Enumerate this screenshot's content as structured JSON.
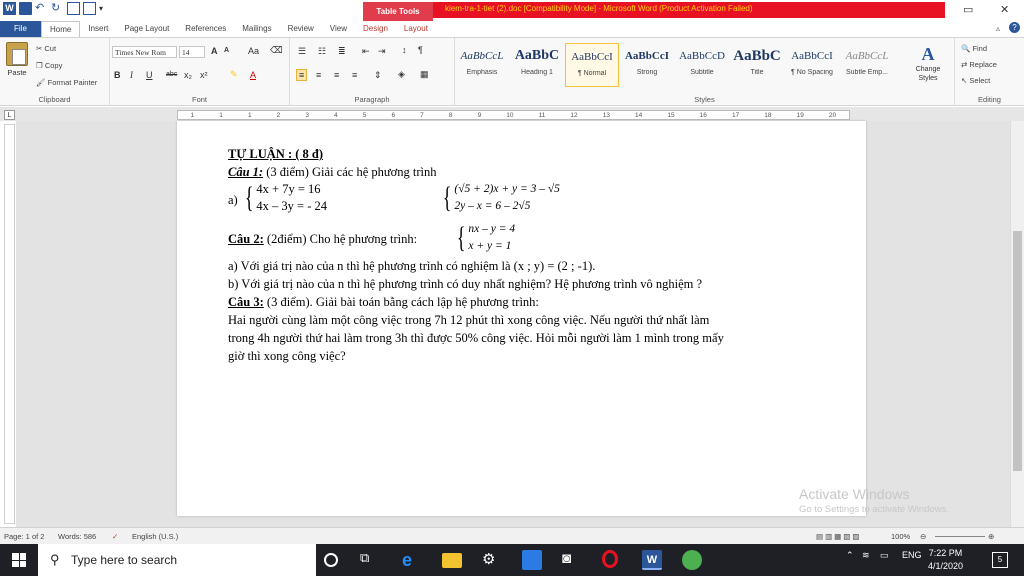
{
  "titlebar": {
    "context_tab": "Table Tools",
    "document_title": "kiem-tra-1-tiet (2).doc [Compatibility Mode] - Microsoft Word (Product Activation Failed)",
    "restore_glyph": "▭",
    "close_glyph": "✕"
  },
  "tabs": [
    {
      "label": "File"
    },
    {
      "label": "Home"
    },
    {
      "label": "Insert"
    },
    {
      "label": "Page Layout"
    },
    {
      "label": "References"
    },
    {
      "label": "Mailings"
    },
    {
      "label": "Review"
    },
    {
      "label": "View"
    },
    {
      "label": "Design"
    },
    {
      "label": "Layout"
    }
  ],
  "clipboard": {
    "paste": "Paste",
    "cut": "Cut",
    "copy": "Copy",
    "format_painter": "Format Painter",
    "label": "Clipboard"
  },
  "font": {
    "name": "Times New Rom",
    "size": "14",
    "label": "Font",
    "bold": "B",
    "italic": "I",
    "underline": "U",
    "strike": "abc",
    "sub": "x₂",
    "sup": "x²",
    "grow": "A",
    "shrink": "A",
    "case": "Aa",
    "color": "A"
  },
  "paragraph": {
    "label": "Paragraph",
    "pilcrow": "¶"
  },
  "styles": {
    "label": "Styles",
    "items": [
      {
        "sample": "AaBbCcL",
        "name": "Emphasis"
      },
      {
        "sample": "AaBbC",
        "name": "Heading 1"
      },
      {
        "sample": "AaBbCcI",
        "name": "¶ Normal"
      },
      {
        "sample": "AaBbCcI",
        "name": "Strong"
      },
      {
        "sample": "AaBbCcD",
        "name": "Subtitle"
      },
      {
        "sample": "AaBbC",
        "name": "Title"
      },
      {
        "sample": "AaBbCcI",
        "name": "¶ No Spacing"
      },
      {
        "sample": "AaBbCcL",
        "name": "Subtle Emp..."
      }
    ],
    "change_styles": "Change Styles",
    "change_styles_icon": "A"
  },
  "editing": {
    "label": "Editing",
    "find": "Find",
    "replace": "Replace",
    "select": "Select"
  },
  "ruler": {
    "numbers": [
      "1",
      "1",
      "1",
      "2",
      "3",
      "4",
      "5",
      "6",
      "7",
      "8",
      "9",
      "10",
      "11",
      "12",
      "13",
      "14",
      "15",
      "16",
      "17",
      "18",
      "19",
      "20"
    ]
  },
  "document": {
    "heading": "TỰ LUẬN : ( 8 đ)",
    "q1_label": "Câu 1:",
    "q1_text": " (3 điểm) Giải các hệ phương trình",
    "q1_a": "a)",
    "q1_a_eq1": "4x + 7y = 16",
    "q1_a_eq2": "4x – 3y = - 24",
    "q1_b_eq1": "(√5 + 2)x + y = 3 – √5",
    "q1_b_eq2": "2y – x = 6 – 2√5",
    "q2_label": "Câu 2:",
    "q2_text": " (2điểm) Cho hệ phương trình:",
    "q2_eq1": "nx – y = 4",
    "q2_eq2": "x + y = 1",
    "q2_a": "a) Với giá trị nào của n thì hệ phương trình có nghiệm là (x ; y) = (2 ; -1).",
    "q2_b": "b) Với giá trị nào của n thì hệ phương trình có duy nhất nghiệm? Hệ phương trình vô nghiệm ?",
    "q3_label": "Câu 3:",
    "q3_text": " (3 điểm). Giải bài toán bằng cách lập hệ phương trình:",
    "q3_line1": "Hai người cùng làm một công việc trong 7h 12 phút thì xong công việc. Nếu người thứ  nhất làm",
    "q3_line2": "trong 4h người thứ hai làm trong 3h thì được 50% công việc. Hỏi mỗi người làm 1 mình trong mấy",
    "q3_line3": "giờ thì xong công việc?"
  },
  "watermark": {
    "line1": "Activate Windows",
    "line2": "Go to Settings to activate Windows."
  },
  "statusbar": {
    "page": "Page: 1 of 2",
    "words": "Words: 586",
    "language": "English (U.S.)",
    "zoom": "100%"
  },
  "taskbar": {
    "search_placeholder": "Type here to search",
    "language": "ENG",
    "time": "7:22 PM",
    "date": "4/1/2020",
    "notifications": "5"
  },
  "colors": {
    "word_blue": "#2b579a",
    "title_red": "#e81123",
    "title_text": "#ffd400",
    "taskbar": "#1f2026"
  }
}
